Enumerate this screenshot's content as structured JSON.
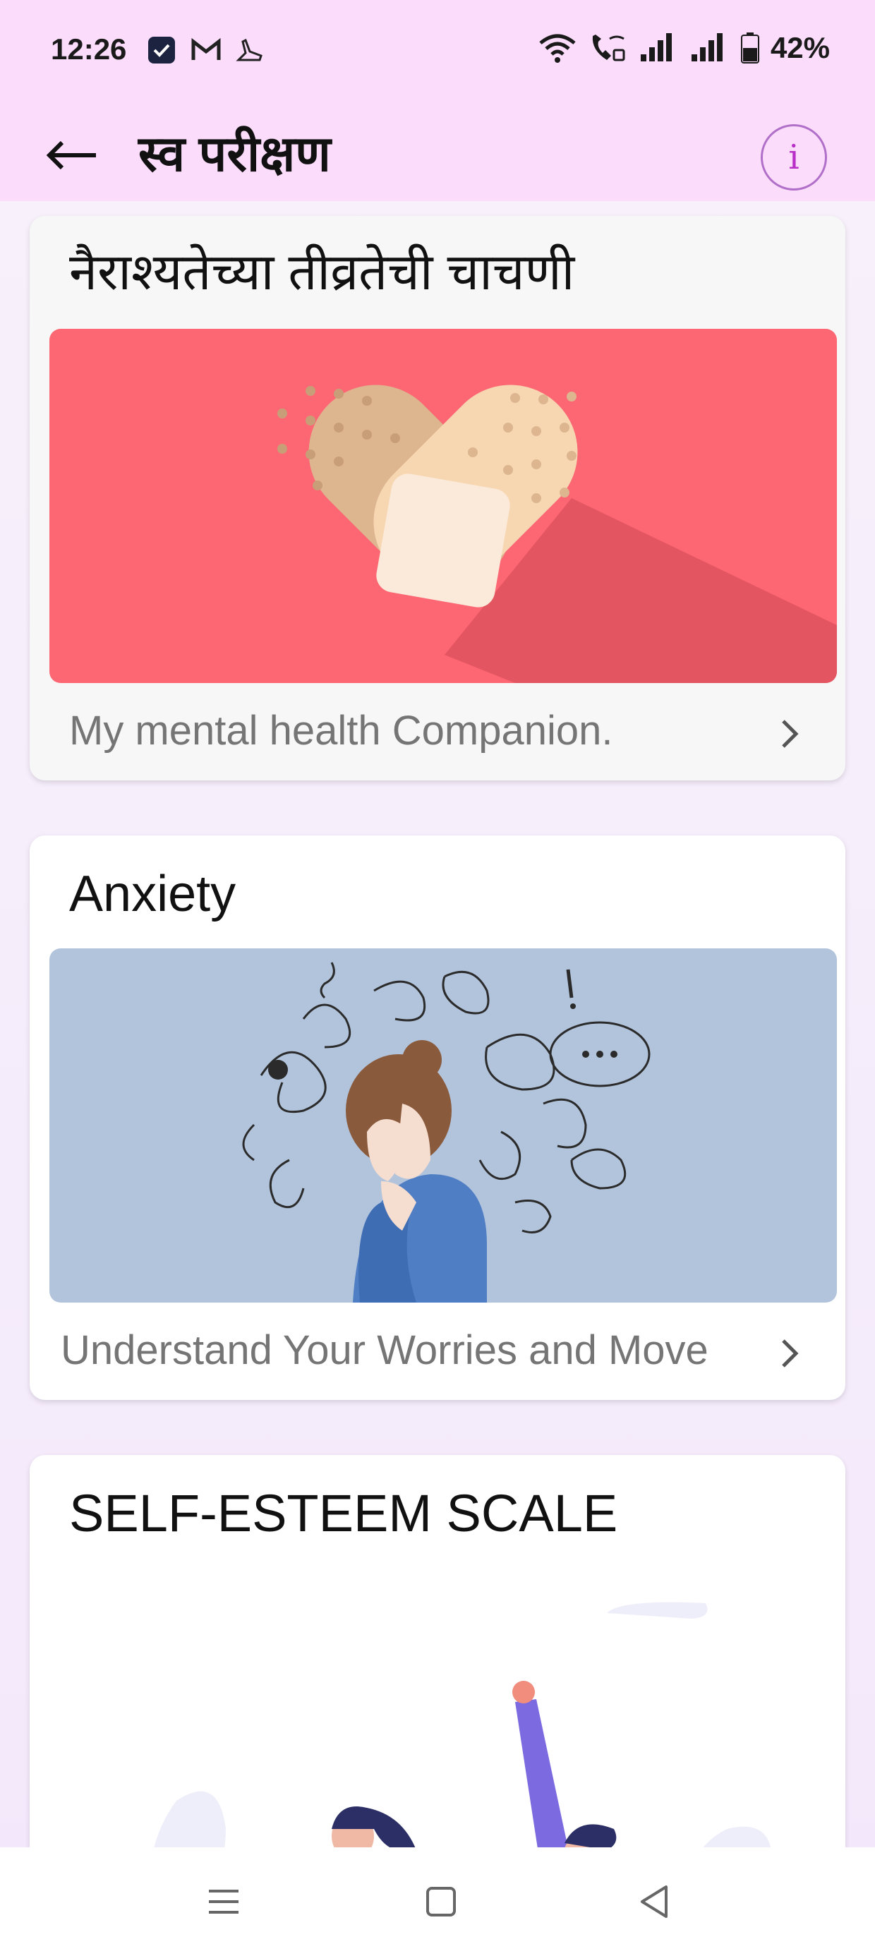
{
  "status_bar": {
    "time": "12:26",
    "battery": "42%",
    "icons": [
      "tasks-app-icon",
      "gmail-icon",
      "shoe-icon",
      "wifi-icon",
      "wifi-calling-icon",
      "signal-icon",
      "signal-icon",
      "battery-icon"
    ]
  },
  "app_bar": {
    "title": "स्व परीक्षण",
    "back_icon": "arrow-left-icon",
    "info_icon": "info-icon",
    "info_glyph": "i"
  },
  "cards": [
    {
      "title": "नैराश्यतेच्या तीव्रतेची चाचणी",
      "subtitle": "My mental health Companion.",
      "image": "heart-bandage-illustration",
      "image_bg": "#fd6673"
    },
    {
      "title": "Anxiety",
      "subtitle": "Understand Your Worries and Move",
      "image": "anxious-woman-illustration",
      "image_bg": "#b2c4dc"
    },
    {
      "title": "SELF-ESTEEM SCALE",
      "subtitle": "",
      "image": "superhero-couple-illustration",
      "image_bg": "#ffffff"
    }
  ],
  "nav_bar": {
    "items": [
      "menu-icon",
      "home-icon",
      "back-triangle-icon"
    ]
  },
  "colors": {
    "app_bar": "#fcdcfb",
    "accent": "#b72fc6",
    "background": "#f5ecfb"
  }
}
